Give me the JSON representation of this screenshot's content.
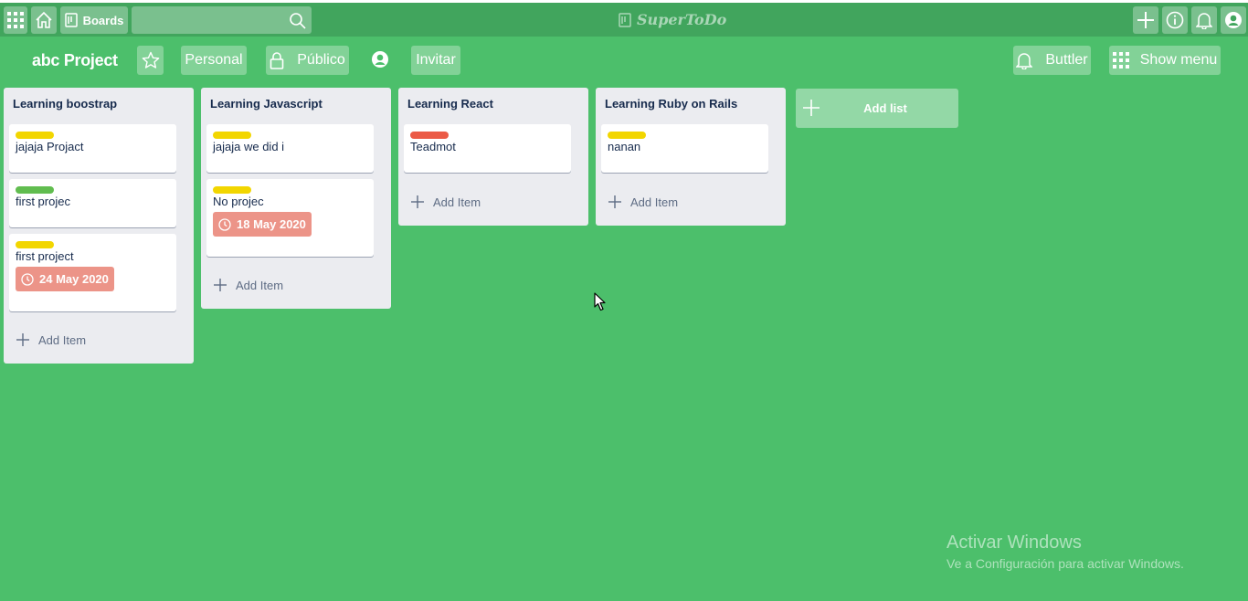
{
  "topbar": {
    "boards_label": "Boards",
    "search_placeholder": "",
    "logo_text": "SuperToDo"
  },
  "board": {
    "title": "abc Project",
    "personal_label": "Personal",
    "visibility_label": "Público",
    "invite_label": "Invitar",
    "butler_label": "Buttler",
    "show_menu_label": "Show menu"
  },
  "lists": [
    {
      "title": "Learning boostrap",
      "add_item_label": "Add Item",
      "cards": [
        {
          "label_color": "#f2d600",
          "text": "jajaja Projact"
        },
        {
          "label_color": "#61bd4f",
          "text": "first projec"
        },
        {
          "label_color": "#f2d600",
          "text": "first project",
          "due": "24 May 2020"
        }
      ]
    },
    {
      "title": "Learning Javascript",
      "add_item_label": "Add Item",
      "cards": [
        {
          "label_color": "#f2d600",
          "text": "jajaja we did i"
        },
        {
          "label_color": "#f2d600",
          "text": "No projec",
          "due": "18 May 2020"
        }
      ]
    },
    {
      "title": "Learning React",
      "add_item_label": "Add Item",
      "cards": [
        {
          "label_color": "#eb5a46",
          "text": "Teadmot"
        }
      ]
    },
    {
      "title": "Learning Ruby on Rails",
      "add_item_label": "Add Item",
      "cards": [
        {
          "label_color": "#f2d600",
          "text": "nanan"
        }
      ]
    }
  ],
  "add_list_label": "Add list",
  "watermark": {
    "title": "Activar Windows",
    "subtitle": "Ve a Configuración para activar Windows."
  },
  "colors": {
    "background": "#4cbf6b",
    "topbar": "#41a55d",
    "due_badge": "#ec9488",
    "list_bg": "#ebecf0"
  }
}
